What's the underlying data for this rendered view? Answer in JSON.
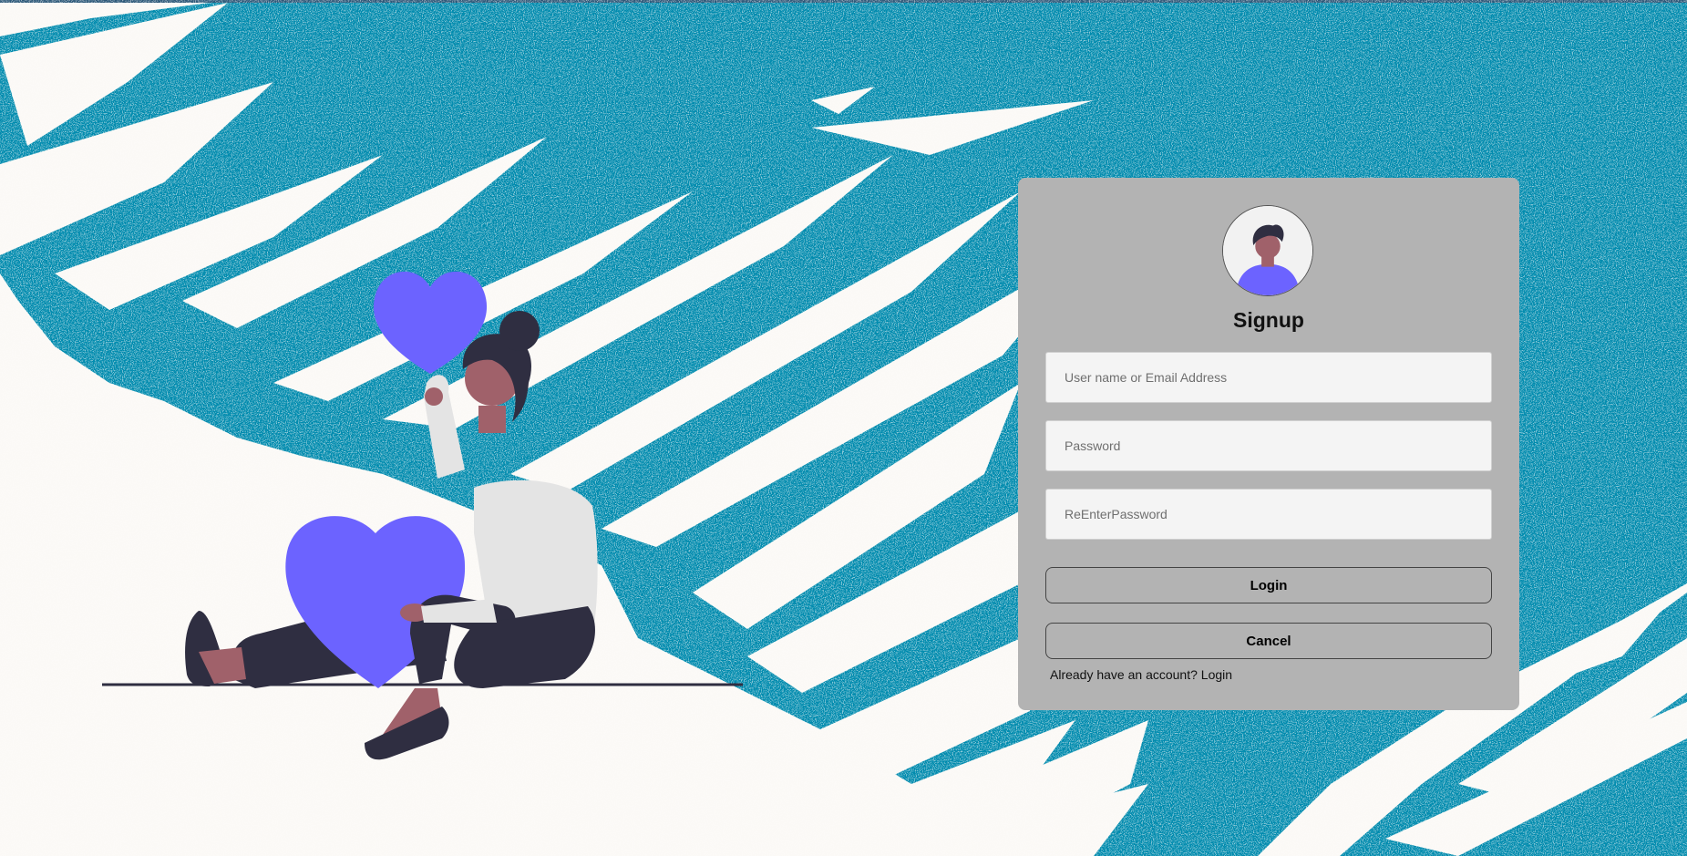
{
  "form": {
    "title": "Signup",
    "username_placeholder": "User name or Email Address",
    "password_placeholder": "Password",
    "reenter_placeholder": "ReEnterPassword",
    "login_button": "Login",
    "cancel_button": "Cancel",
    "footer_prefix": "Already have an account?",
    "footer_link": "Login"
  },
  "colors": {
    "background_teal": "#008bae",
    "background_white": "#fbf9f6",
    "card": "#b3b3b3",
    "accent_purple": "#6c63ff",
    "skin": "#a0616a",
    "dark": "#2f2e41"
  }
}
